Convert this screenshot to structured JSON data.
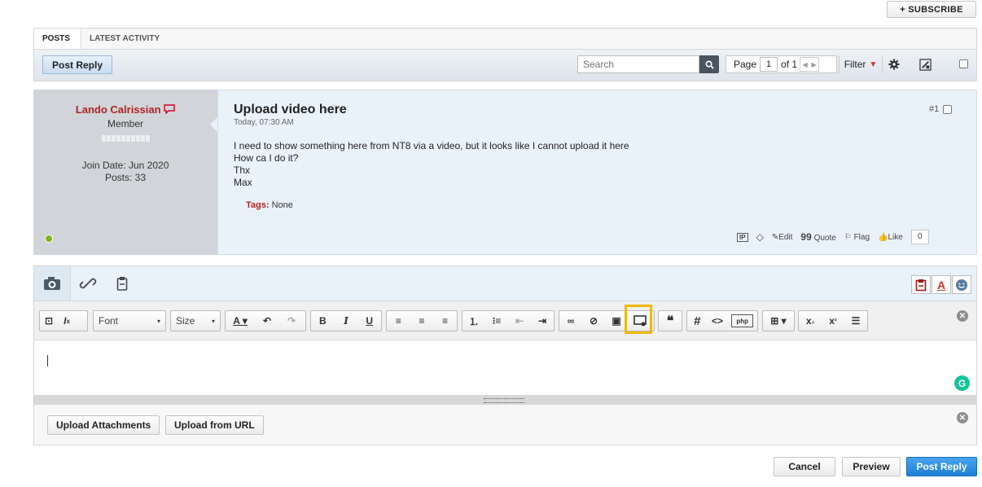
{
  "header": {
    "subscribe_label": "+ SUBSCRIBE"
  },
  "tabs": [
    {
      "label": "POSTS"
    },
    {
      "label": "LATEST ACTIVITY"
    }
  ],
  "toolbar": {
    "post_reply_label": "Post Reply",
    "search_placeholder": "Search",
    "page_label": "Page",
    "page_value": "1",
    "page_of": "of 1",
    "filter_label": "Filter"
  },
  "post": {
    "author": "Lando Calrissian",
    "role": "Member",
    "join_date": "Join Date: Jun 2020",
    "posts": "Posts: 33",
    "title": "Upload video here",
    "date": "Today, 07:30 AM",
    "body_lines": [
      "I need to show something here from NT8 via a video, but it looks like I cannot upload it here",
      "How ca I do it?",
      "Thx",
      "Max"
    ],
    "tags_label": "Tags:",
    "tags_value": "None",
    "number": "#1",
    "actions": {
      "edit": "Edit",
      "quote": "Quote",
      "flag": "Flag",
      "like": "Like",
      "like_count": "0"
    }
  },
  "editor": {
    "font_label": "Font",
    "size_label": "Size",
    "highlighted_tool": "insert-video-icon"
  },
  "attachments": {
    "upload_attachments_label": "Upload Attachments",
    "upload_url_label": "Upload from URL"
  },
  "footer": {
    "cancel_label": "Cancel",
    "preview_label": "Preview",
    "post_reply_label": "Post Reply"
  },
  "colors": {
    "author_red": "#b22222",
    "primary_blue": "#1f7fd4",
    "highlight_yellow": "#f2b705",
    "online_green": "#7cb518",
    "grammarly_green": "#15c39a"
  }
}
